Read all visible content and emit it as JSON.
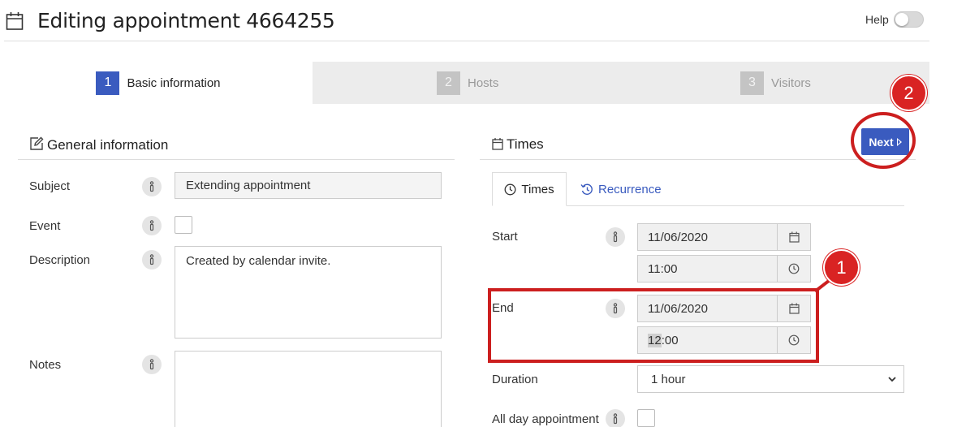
{
  "header": {
    "title": "Editing appointment 4664255",
    "help_label": "Help",
    "help_toggle_on": false
  },
  "steps": [
    {
      "number": "1",
      "label": "Basic information",
      "active": true
    },
    {
      "number": "2",
      "label": "Hosts",
      "active": false
    },
    {
      "number": "3",
      "label": "Visitors",
      "active": false
    }
  ],
  "general": {
    "heading": "General information",
    "subject_label": "Subject",
    "subject_value": "Extending appointment",
    "event_label": "Event",
    "event_checked": false,
    "description_label": "Description",
    "description_value": "Created by calendar invite.",
    "notes_label": "Notes",
    "notes_value": ""
  },
  "times": {
    "heading": "Times",
    "next_label": "Next",
    "tabs": [
      {
        "label": "Times",
        "icon": "clock-icon",
        "active": true
      },
      {
        "label": "Recurrence",
        "icon": "history-icon",
        "active": false
      }
    ],
    "start_label": "Start",
    "start_date": "11/06/2020",
    "start_time": "11:00",
    "end_label": "End",
    "end_date": "11/06/2020",
    "end_time_selected": "12",
    "end_time_rest": ":00",
    "duration_label": "Duration",
    "duration_value": "1 hour",
    "all_day_label": "All day appointment",
    "all_day_checked": false
  },
  "annotations": [
    {
      "number": "1",
      "color": "#d92323"
    },
    {
      "number": "2",
      "color": "#d92323"
    }
  ],
  "colors": {
    "accent": "#3a5bbf",
    "annotation": "#cc1f1f"
  }
}
